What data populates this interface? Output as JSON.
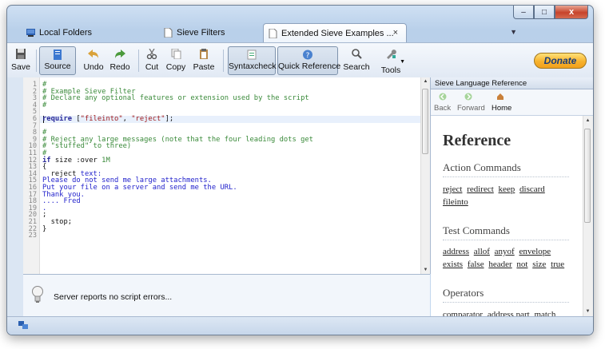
{
  "window": {
    "tabs": [
      {
        "label": "Local Folders",
        "icon": "folder-icon"
      },
      {
        "label": "Sieve Filters",
        "icon": "document-icon",
        "close": "×"
      },
      {
        "label": "Extended Sieve Examples ...",
        "icon": "document-icon",
        "close": "×"
      }
    ],
    "caption": {
      "minimize": "–",
      "maximize": "□",
      "close": "x"
    }
  },
  "toolbar": {
    "save": "Save",
    "source": "Source",
    "undo": "Undo",
    "redo": "Redo",
    "cut": "Cut",
    "copy": "Copy",
    "paste": "Paste",
    "syntaxcheck": "Syntaxcheck",
    "quick_reference": "Quick Reference",
    "search": "Search",
    "tools": "Tools",
    "donate": "Donate"
  },
  "editor": {
    "lines": [
      "#",
      "# Example Sieve Filter",
      "# Declare any optional features or extension used by the script",
      "#",
      "",
      "require [\"fileinto\", \"reject\"];",
      "",
      "#",
      "# Reject any large messages (note that the four leading dots get",
      "# \"stuffed\" to three)",
      "#",
      "if size :over 1M",
      "{",
      "  reject text:",
      "Please do not send me large attachments.",
      "Put your file on a server and send me the URL.",
      "Thank you.",
      ".... Fred",
      ".",
      ";",
      "  stop;",
      "}",
      ""
    ],
    "line_numbers": [
      "1",
      "2",
      "3",
      "4",
      "5",
      "6",
      "7",
      "8",
      "9",
      "10",
      "11",
      "12",
      "13",
      "14",
      "15",
      "16",
      "17",
      "18",
      "19",
      "20",
      "21",
      "22",
      "23"
    ]
  },
  "status": {
    "message": "Server reports no script errors..."
  },
  "reference": {
    "header": "Sieve Language Reference",
    "nav": {
      "back": "Back",
      "forward": "Forward",
      "home": "Home"
    },
    "title": "Reference",
    "sections": [
      {
        "title": "Action Commands",
        "links": [
          "reject",
          "redirect",
          "keep",
          "discard",
          "fileinto"
        ]
      },
      {
        "title": "Test Commands",
        "links": [
          "address",
          "allof",
          "anyof",
          "envelope",
          "exists",
          "false",
          "header",
          "not",
          "size",
          "true"
        ]
      },
      {
        "title": "Operators",
        "links": [
          "comparator",
          "address part",
          "match"
        ]
      }
    ]
  }
}
